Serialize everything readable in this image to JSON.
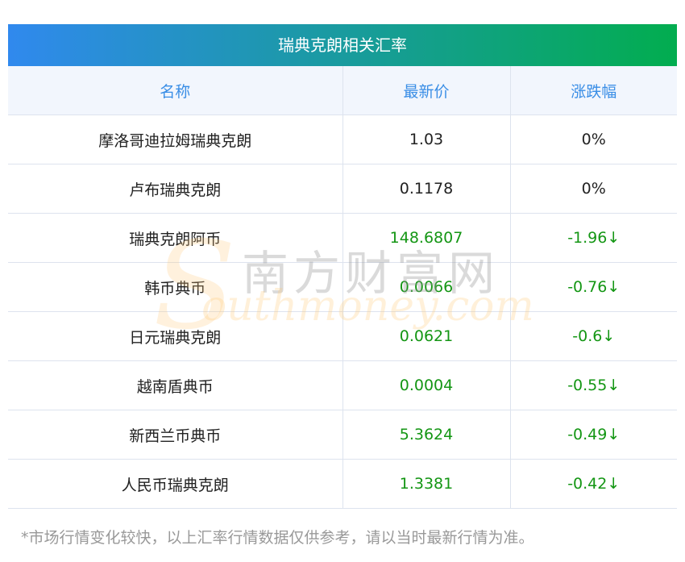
{
  "title": "瑞典克朗相关汇率",
  "headers": [
    "名称",
    "最新价",
    "涨跌幅"
  ],
  "rows": [
    {
      "name": "摩洛哥迪拉姆瑞典克朗",
      "price": "1.03",
      "change": "0%",
      "trend": "flat"
    },
    {
      "name": "卢布瑞典克朗",
      "price": "0.1178",
      "change": "0%",
      "trend": "flat"
    },
    {
      "name": "瑞典克朗阿币",
      "price": "148.6807",
      "change": "-1.96↓",
      "trend": "down"
    },
    {
      "name": "韩币典币",
      "price": "0.0066",
      "change": "-0.76↓",
      "trend": "down"
    },
    {
      "name": "日元瑞典克朗",
      "price": "0.0621",
      "change": "-0.6↓",
      "trend": "down"
    },
    {
      "name": "越南盾典币",
      "price": "0.0004",
      "change": "-0.55↓",
      "trend": "down"
    },
    {
      "name": "新西兰币典币",
      "price": "5.3624",
      "change": "-0.49↓",
      "trend": "down"
    },
    {
      "name": "人民币瑞典克朗",
      "price": "1.3381",
      "change": "-0.42↓",
      "trend": "down"
    }
  ],
  "watermark": {
    "cn": "南方财富网",
    "s": "S",
    "en": "outhmoney.com"
  },
  "note": "*市场行情变化较快，以上汇率行情数据仅供参考，请以当时最新行情为准。",
  "colors": {
    "header_start": "#3089ee",
    "header_end": "#02ad4f",
    "down": "#149614",
    "header_text": "#3a8ee6"
  }
}
